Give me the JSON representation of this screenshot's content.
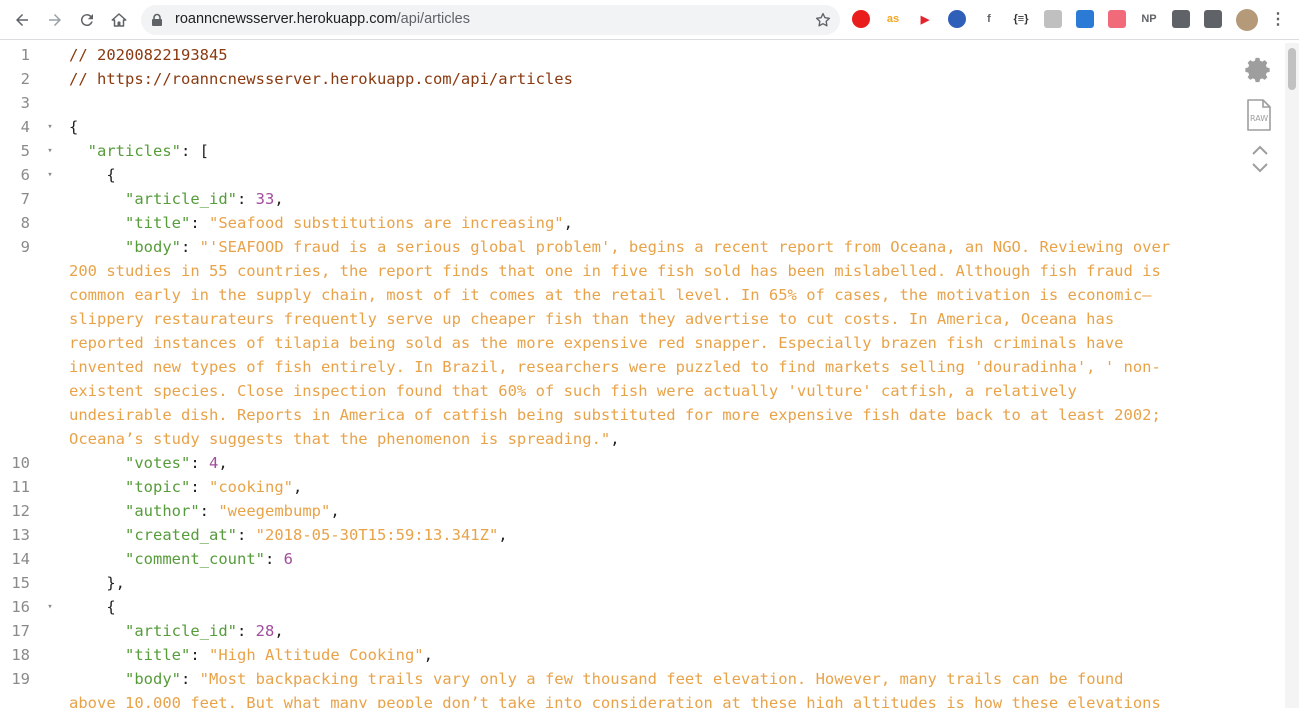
{
  "browser": {
    "url_host": "roanncnewsserver.herokuapp.com",
    "url_path": "/api/articles",
    "extensions": [
      {
        "icon": "opera-red-icon",
        "text": "",
        "color": "#ea1d1d"
      },
      {
        "icon": "lastfm-icon",
        "text": "as",
        "color": "#f5a623"
      },
      {
        "icon": "youtube-icon",
        "text": "▶",
        "color": "#e5232c"
      },
      {
        "icon": "clock-icon",
        "text": "",
        "color": "#2f5fb8"
      },
      {
        "icon": "facebook-icon",
        "text": "f",
        "color": "#5f6368"
      },
      {
        "icon": "json-braces-icon",
        "text": "{≡}",
        "color": "#333333"
      },
      {
        "icon": "grid-icon",
        "text": "",
        "color": "#c0c0c0"
      },
      {
        "icon": "triangle-icon",
        "text": "",
        "color": "#2a7ad6"
      },
      {
        "icon": "arrow-icon",
        "text": "",
        "color": "#f06a7a"
      },
      {
        "icon": "np-icon",
        "text": "NP",
        "color": "#5f6368"
      },
      {
        "icon": "puzzle-icon",
        "text": "",
        "color": "#5f6368"
      },
      {
        "icon": "playlist-icon",
        "text": "",
        "color": "#5f6368"
      }
    ]
  },
  "lines": [
    {
      "n": "1",
      "fold": "",
      "tokens": [
        [
          "comment",
          "// 20200822193845"
        ]
      ]
    },
    {
      "n": "2",
      "fold": "",
      "tokens": [
        [
          "comment",
          "// https://roanncnewsserver.herokuapp.com/api/articles"
        ]
      ]
    },
    {
      "n": "3",
      "fold": "",
      "tokens": []
    },
    {
      "n": "4",
      "fold": "▾",
      "tokens": [
        [
          "punc",
          "{"
        ]
      ]
    },
    {
      "n": "5",
      "fold": "▾",
      "tokens": [
        [
          "punc",
          "  "
        ],
        [
          "key",
          "\"articles\""
        ],
        [
          "punc",
          ": ["
        ]
      ]
    },
    {
      "n": "6",
      "fold": "▾",
      "tokens": [
        [
          "punc",
          "    {"
        ]
      ]
    },
    {
      "n": "7",
      "fold": "",
      "tokens": [
        [
          "punc",
          "      "
        ],
        [
          "key",
          "\"article_id\""
        ],
        [
          "punc",
          ": "
        ],
        [
          "num",
          "33"
        ],
        [
          "punc",
          ","
        ]
      ]
    },
    {
      "n": "8",
      "fold": "",
      "tokens": [
        [
          "punc",
          "      "
        ],
        [
          "key",
          "\"title\""
        ],
        [
          "punc",
          ": "
        ],
        [
          "str",
          "\"Seafood substitutions are increasing\""
        ],
        [
          "punc",
          ","
        ]
      ]
    },
    {
      "n": "9",
      "fold": "",
      "tokens": [
        [
          "punc",
          "      "
        ],
        [
          "key",
          "\"body\""
        ],
        [
          "punc",
          ": "
        ],
        [
          "str",
          "\"'SEAFOOD fraud is a serious global problem', begins a recent report from Oceana, an NGO. Reviewing over"
        ]
      ]
    },
    {
      "n": "",
      "fold": "",
      "tokens": [
        [
          "str",
          "200 studies in 55 countries, the report finds that one in five fish sold has been mislabelled. Although fish fraud is"
        ]
      ]
    },
    {
      "n": "",
      "fold": "",
      "tokens": [
        [
          "str",
          "common early in the supply chain, most of it comes at the retail level. In 65% of cases, the motivation is economic—"
        ]
      ]
    },
    {
      "n": "",
      "fold": "",
      "tokens": [
        [
          "str",
          "slippery restaurateurs frequently serve up cheaper fish than they advertise to cut costs. In America, Oceana has"
        ]
      ]
    },
    {
      "n": "",
      "fold": "",
      "tokens": [
        [
          "str",
          "reported instances of tilapia being sold as the more expensive red snapper. Especially brazen fish criminals have"
        ]
      ]
    },
    {
      "n": "",
      "fold": "",
      "tokens": [
        [
          "str",
          "invented new types of fish entirely. In Brazil, researchers were puzzled to find markets selling 'douradinha', ' non-"
        ]
      ]
    },
    {
      "n": "",
      "fold": "",
      "tokens": [
        [
          "str",
          "existent species. Close inspection found that 60% of such fish were actually 'vulture' catfish, a relatively"
        ]
      ]
    },
    {
      "n": "",
      "fold": "",
      "tokens": [
        [
          "str",
          "undesirable dish. Reports in America of catfish being substituted for more expensive fish date back to at least 2002;"
        ]
      ]
    },
    {
      "n": "",
      "fold": "",
      "tokens": [
        [
          "str",
          "Oceana’s study suggests that the phenomenon is spreading.\""
        ],
        [
          "punc",
          ","
        ]
      ]
    },
    {
      "n": "10",
      "fold": "",
      "tokens": [
        [
          "punc",
          "      "
        ],
        [
          "key",
          "\"votes\""
        ],
        [
          "punc",
          ": "
        ],
        [
          "num",
          "4"
        ],
        [
          "punc",
          ","
        ]
      ]
    },
    {
      "n": "11",
      "fold": "",
      "tokens": [
        [
          "punc",
          "      "
        ],
        [
          "key",
          "\"topic\""
        ],
        [
          "punc",
          ": "
        ],
        [
          "str",
          "\"cooking\""
        ],
        [
          "punc",
          ","
        ]
      ]
    },
    {
      "n": "12",
      "fold": "",
      "tokens": [
        [
          "punc",
          "      "
        ],
        [
          "key",
          "\"author\""
        ],
        [
          "punc",
          ": "
        ],
        [
          "str",
          "\"weegembump\""
        ],
        [
          "punc",
          ","
        ]
      ]
    },
    {
      "n": "13",
      "fold": "",
      "tokens": [
        [
          "punc",
          "      "
        ],
        [
          "key",
          "\"created_at\""
        ],
        [
          "punc",
          ": "
        ],
        [
          "str",
          "\"2018-05-30T15:59:13.341Z\""
        ],
        [
          "punc",
          ","
        ]
      ]
    },
    {
      "n": "14",
      "fold": "",
      "tokens": [
        [
          "punc",
          "      "
        ],
        [
          "key",
          "\"comment_count\""
        ],
        [
          "punc",
          ": "
        ],
        [
          "num",
          "6"
        ]
      ]
    },
    {
      "n": "15",
      "fold": "",
      "tokens": [
        [
          "punc",
          "    },"
        ]
      ]
    },
    {
      "n": "16",
      "fold": "▾",
      "tokens": [
        [
          "punc",
          "    {"
        ]
      ]
    },
    {
      "n": "17",
      "fold": "",
      "tokens": [
        [
          "punc",
          "      "
        ],
        [
          "key",
          "\"article_id\""
        ],
        [
          "punc",
          ": "
        ],
        [
          "num",
          "28"
        ],
        [
          "punc",
          ","
        ]
      ]
    },
    {
      "n": "18",
      "fold": "",
      "tokens": [
        [
          "punc",
          "      "
        ],
        [
          "key",
          "\"title\""
        ],
        [
          "punc",
          ": "
        ],
        [
          "str",
          "\"High Altitude Cooking\""
        ],
        [
          "punc",
          ","
        ]
      ]
    },
    {
      "n": "19",
      "fold": "",
      "tokens": [
        [
          "punc",
          "      "
        ],
        [
          "key",
          "\"body\""
        ],
        [
          "punc",
          ": "
        ],
        [
          "str",
          "\"Most backpacking trails vary only a few thousand feet elevation. However, many trails can be found"
        ]
      ]
    },
    {
      "n": "",
      "fold": "",
      "tokens": [
        [
          "str",
          "above 10,000 feet. But what many people don’t take into consideration at these high altitudes is how these elevations"
        ]
      ]
    }
  ],
  "tools": {
    "raw_label": "RAW"
  }
}
